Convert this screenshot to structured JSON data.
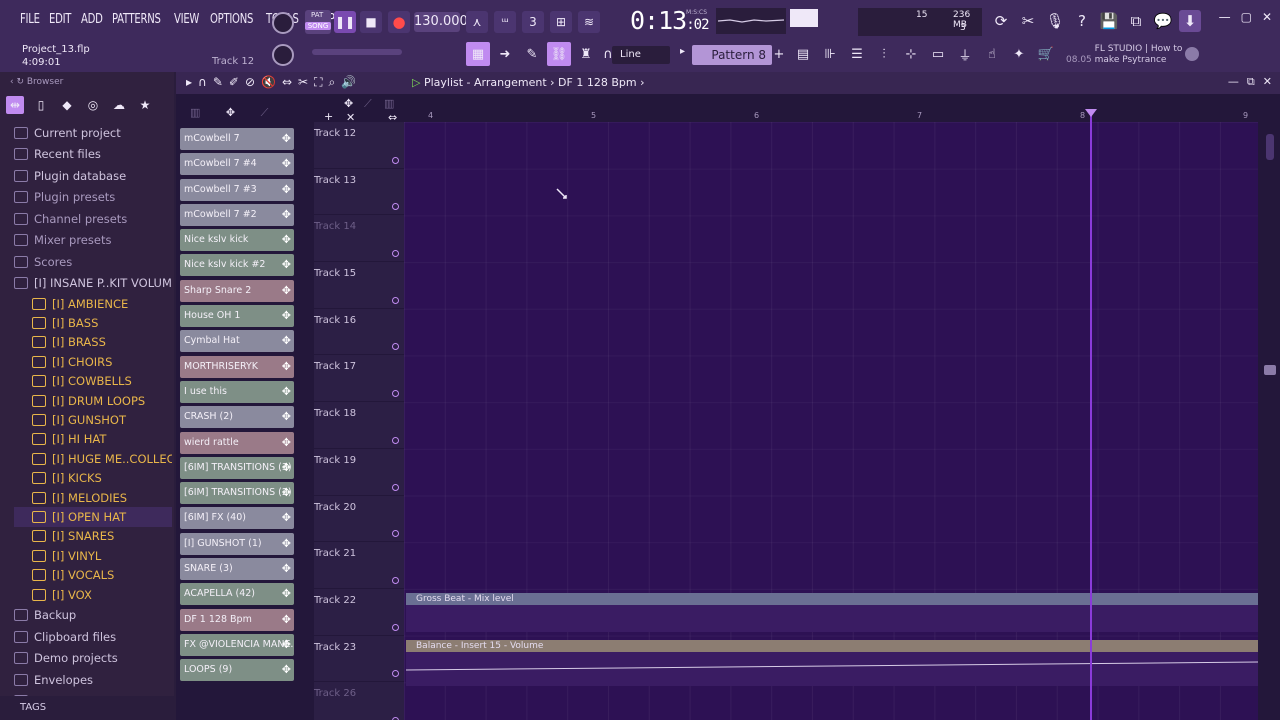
{
  "menu": [
    "FILE",
    "EDIT",
    "ADD",
    "PATTERNS",
    "VIEW",
    "OPTIONS",
    "TOOLS",
    "HELP"
  ],
  "project": {
    "name": "Project_13.flp",
    "time": "4:09:01",
    "hint": "Track 12"
  },
  "transport": {
    "pat": "PAT",
    "song": "SONG",
    "tempo": "130.000",
    "time_main": "0:13",
    "time_sub": "02",
    "time_units": "M:S:CS"
  },
  "cpu": {
    "value": "15",
    "memory": "236 MB",
    "polyphony": "3"
  },
  "snap": {
    "label": "Line"
  },
  "pattern": {
    "label": "Pattern 8"
  },
  "news": {
    "time": "08.05",
    "text": "FL STUDIO | How to make Psytrance"
  },
  "browser": {
    "title": "Browser",
    "items": [
      {
        "label": "Current project",
        "type": "top"
      },
      {
        "label": "Recent files",
        "type": "top"
      },
      {
        "label": "Plugin database",
        "type": "top"
      },
      {
        "label": "Plugin presets",
        "type": "dim"
      },
      {
        "label": "Channel presets",
        "type": "dim"
      },
      {
        "label": "Mixer presets",
        "type": "dim"
      },
      {
        "label": "Scores",
        "type": "dim"
      },
      {
        "label": "[I] INSANE P..KIT VOLUME 1",
        "type": "top"
      },
      {
        "label": "[I] AMBIENCE",
        "type": "sub"
      },
      {
        "label": "[I] BASS",
        "type": "sub"
      },
      {
        "label": "[I] BRASS",
        "type": "sub"
      },
      {
        "label": "[I] CHOIRS",
        "type": "sub"
      },
      {
        "label": "[I] COWBELLS",
        "type": "sub"
      },
      {
        "label": "[I] DRUM LOOPS",
        "type": "sub"
      },
      {
        "label": "[I] GUNSHOT",
        "type": "sub"
      },
      {
        "label": "[I] HI HAT",
        "type": "sub"
      },
      {
        "label": "[I] HUGE ME..COLLECTION",
        "type": "sub"
      },
      {
        "label": "[I] KICKS",
        "type": "sub"
      },
      {
        "label": "[I] MELODIES",
        "type": "sub"
      },
      {
        "label": "[I] OPEN HAT",
        "type": "sub-hi"
      },
      {
        "label": "[I] SNARES",
        "type": "sub"
      },
      {
        "label": "[I] VINYL",
        "type": "sub"
      },
      {
        "label": "[I] VOCALS",
        "type": "sub"
      },
      {
        "label": "[I] VOX",
        "type": "sub"
      },
      {
        "label": "Backup",
        "type": "top"
      },
      {
        "label": "Clipboard files",
        "type": "top"
      },
      {
        "label": "Demo projects",
        "type": "top"
      },
      {
        "label": "Envelopes",
        "type": "top"
      },
      {
        "label": "Impulses",
        "type": "top"
      }
    ],
    "footer": "TAGS"
  },
  "playlist": {
    "title": "Playlist - Arrangement",
    "breadcrumb": "DF 1 128 Bpm",
    "clips": [
      {
        "label": "mCowbell 7",
        "kind": "pattern"
      },
      {
        "label": "mCowbell 7 #4",
        "kind": "pattern"
      },
      {
        "label": "mCowbell 7 #3",
        "kind": "pattern"
      },
      {
        "label": "mCowbell 7 #2",
        "kind": "pattern"
      },
      {
        "label": "Nice kslv kick",
        "kind": "audio"
      },
      {
        "label": "Nice kslv kick #2",
        "kind": "audio"
      },
      {
        "label": "Sharp Snare 2",
        "kind": "pinkish"
      },
      {
        "label": "House OH 1",
        "kind": "audio"
      },
      {
        "label": "Cymbal Hat",
        "kind": "pattern"
      },
      {
        "label": "MORTHRISERYK",
        "kind": "pinkish"
      },
      {
        "label": "I use this",
        "kind": "audio"
      },
      {
        "label": "CRASH (2)",
        "kind": "pattern"
      },
      {
        "label": "wierd rattle",
        "kind": "pinkish"
      },
      {
        "label": "[6IM] TRANSITIONS (3)",
        "kind": "audio"
      },
      {
        "label": "[6IM] TRANSITIONS (2)",
        "kind": "audio"
      },
      {
        "label": "[6IM] FX (40)",
        "kind": "pattern"
      },
      {
        "label": "[I] GUNSHOT (1)",
        "kind": "pattern"
      },
      {
        "label": "SNARE (3)",
        "kind": "pattern"
      },
      {
        "label": "ACAPELLA (42)",
        "kind": "audio"
      },
      {
        "label": "DF 1 128 Bpm",
        "kind": "pinkish"
      },
      {
        "label": "FX @VIOLENCIA MANE...",
        "kind": "audio"
      },
      {
        "label": "LOOPS (9)",
        "kind": "audio"
      }
    ],
    "tracks": [
      {
        "label": "Track 12",
        "muted": false
      },
      {
        "label": "Track 13",
        "muted": false
      },
      {
        "label": "Track 14",
        "muted": true
      },
      {
        "label": "Track 15",
        "muted": false
      },
      {
        "label": "Track 16",
        "muted": false
      },
      {
        "label": "Track 17",
        "muted": false
      },
      {
        "label": "Track 18",
        "muted": false
      },
      {
        "label": "Track 19",
        "muted": false
      },
      {
        "label": "Track 20",
        "muted": false
      },
      {
        "label": "Track 21",
        "muted": false
      },
      {
        "label": "Track 22",
        "muted": false
      },
      {
        "label": "Track 23",
        "muted": false
      },
      {
        "label": "Track 26",
        "muted": true
      }
    ],
    "ruler": [
      "4",
      "5",
      "6",
      "7",
      "8",
      "9"
    ],
    "automation": [
      {
        "label": "Gross Beat - Mix level"
      },
      {
        "label": "Balance - Insert 15 - Volume"
      }
    ]
  }
}
